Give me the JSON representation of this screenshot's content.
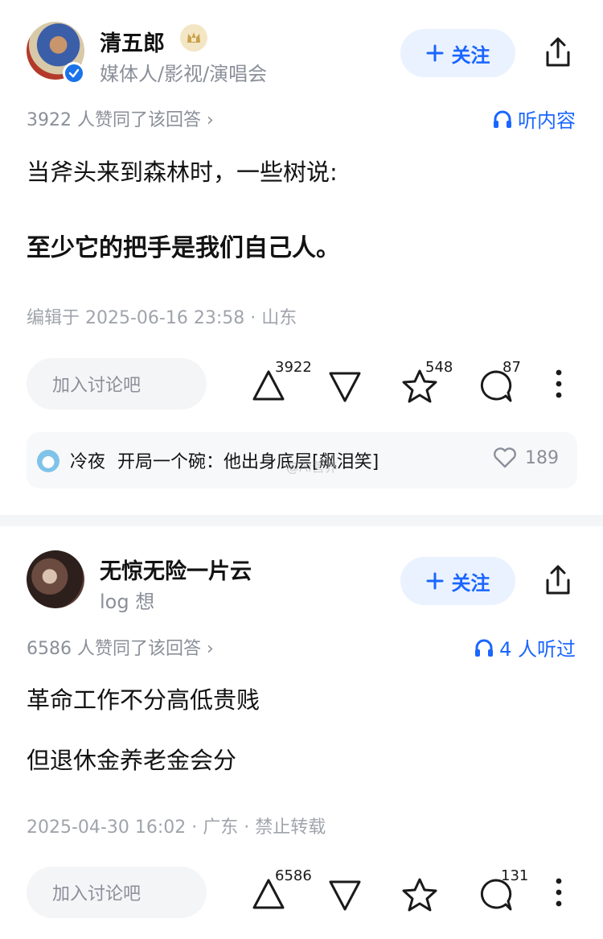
{
  "answers": [
    {
      "author": {
        "name": "清五郎",
        "bio": "媒体人/影视/演唱会"
      },
      "follow_label": "关注",
      "vote_summary": "3922 人赞同了该回答 ›",
      "listen_label": "听内容",
      "content": [
        "当斧头来到森林时，一些树说:",
        "至少它的把手是我们自己人。"
      ],
      "meta": "编辑于 2025-06-16 23:58 · 山东",
      "discuss_placeholder": "加入讨论吧",
      "upvotes": "3922",
      "favorites": "548",
      "comments": "87",
      "top_comment": {
        "user": "冷夜",
        "text": "开局一个碗：他出身底层[飙泪笑]",
        "likes": "189"
      },
      "watermark": "@AI营养"
    },
    {
      "author": {
        "name": "无惊无险一片云",
        "bio": "log 想"
      },
      "follow_label": "关注",
      "vote_summary": "6586 人赞同了该回答 ›",
      "listen_label": "4 人听过",
      "content": [
        "革命工作不分高低贵贱",
        "但退休金养老金会分"
      ],
      "meta": "2025-04-30 16:02 · 广东 · 禁止转载",
      "discuss_placeholder": "加入讨论吧",
      "upvotes": "6586",
      "favorites": "",
      "comments": "131"
    }
  ],
  "colors": {
    "accent": "#1a66ff",
    "follow_bg": "#ebf2ff",
    "muted": "#8a8f99"
  },
  "icons": [
    "verified-icon",
    "rank-badge-icon",
    "plus-icon",
    "share-icon",
    "headphones-icon",
    "upvote-icon",
    "downvote-icon",
    "star-icon",
    "comment-icon",
    "more-icon",
    "heart-icon"
  ]
}
